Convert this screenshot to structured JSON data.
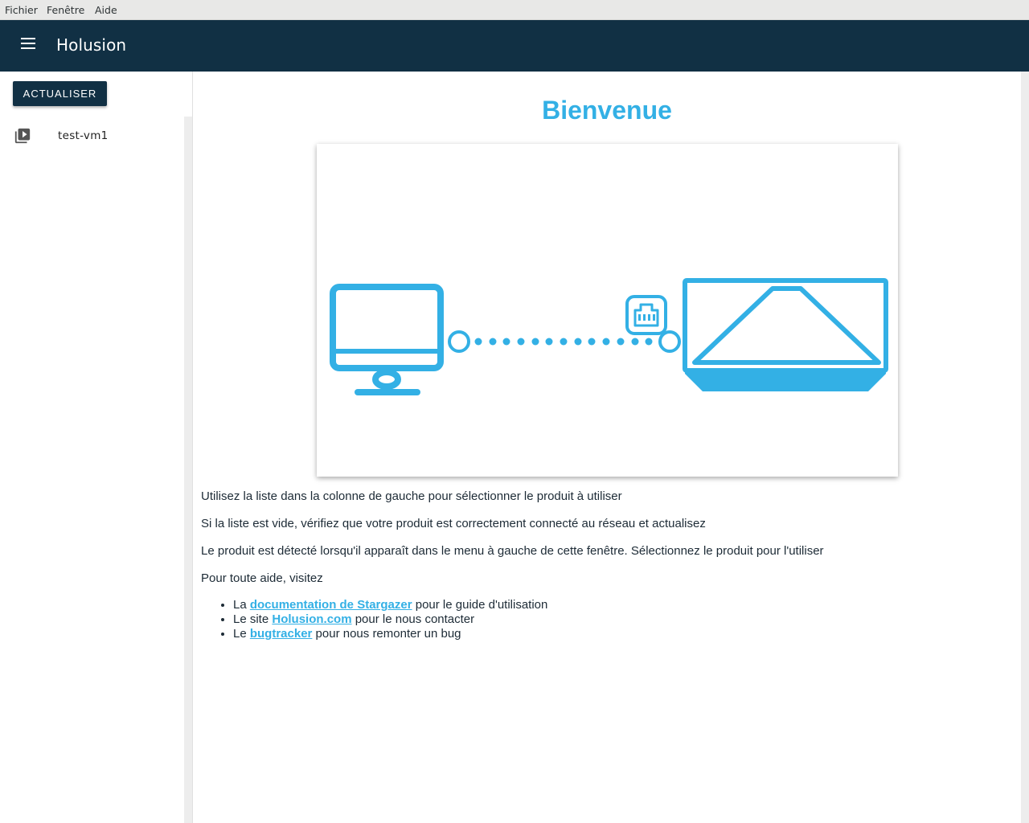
{
  "menubar": {
    "items": [
      "Fichier",
      "Fenêtre",
      "Aide"
    ]
  },
  "appbar": {
    "title": "Holusion",
    "menu_icon": "hamburger-menu-icon"
  },
  "sidebar": {
    "refresh_label": "ACTUALISER",
    "devices": [
      {
        "label": "test-vm1",
        "icon": "video-library-icon"
      }
    ]
  },
  "main": {
    "heading": "Bienvenue",
    "paragraphs": [
      "Utilisez la liste dans la colonne de gauche pour sélectionner le produit à utiliser",
      "Si la liste est vide, vérifiez que votre produit est correctement connecté au réseau et actualisez",
      "Le produit est détecté lorsqu'il apparaît dans le menu à gauche de cette fenêtre. Sélectionnez le produit pour l'utiliser",
      "Pour toute aide, visitez"
    ],
    "help_links": [
      {
        "prefix": "La ",
        "link": "documentation de Stargazer",
        "suffix": " pour le guide d'utilisation"
      },
      {
        "prefix": "Le site ",
        "link": "Holusion.com",
        "suffix": " pour le nous contacter"
      },
      {
        "prefix": "Le ",
        "link": "bugtracker",
        "suffix": " pour nous remonter un bug"
      }
    ]
  },
  "colors": {
    "accent": "#33b0e5",
    "appbar": "#113044",
    "text": "#1d2b36"
  }
}
